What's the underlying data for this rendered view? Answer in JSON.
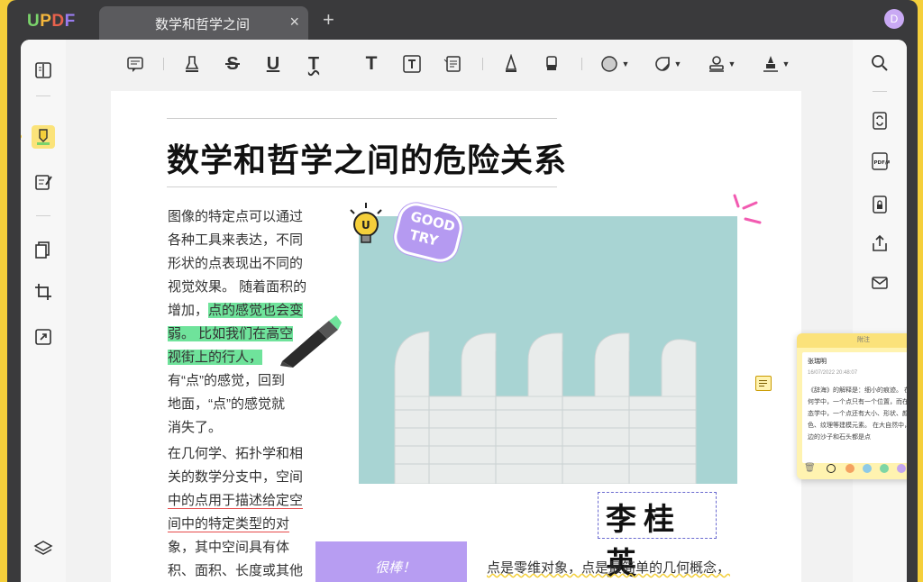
{
  "app": {
    "logo": "UPDF",
    "avatar_initial": "D"
  },
  "tabs": [
    {
      "title": "数学和哲学之间",
      "close": "×"
    }
  ],
  "new_tab": "+",
  "toolbar": {
    "tools": [
      "comment",
      "highlight",
      "strikethrough",
      "underline",
      "squiggly",
      "text",
      "textbox",
      "text-callout",
      "pencil",
      "eraser",
      "shape",
      "sticker",
      "stamp",
      "signature"
    ]
  },
  "document": {
    "title": "数学和哲学之间的危险关系",
    "left_col_1": [
      "图像的特定点可以通过",
      "各种工具来表达，不同",
      "形状的点表现出不同的",
      "视觉效果。 随着面积的"
    ],
    "left_col_hl": {
      "pre": "增加，",
      "hl1": "点的感觉也会变",
      "hl2": "弱。 比如我们在高空",
      "hl3": "视街上的行人，"
    },
    "left_col_2": [
      "有“点”的感觉，回到",
      "地面，“点”的感觉就",
      "消失了。"
    ],
    "left_col_3": [
      "在几何学、拓扑学和相",
      "关的数学分支中，空间"
    ],
    "left_col_ul": [
      "中的点用于描述给定空",
      "间中的特定类型的对"
    ],
    "left_col_4": [
      "象，其中空间具有体",
      "积、面积、长度或其他"
    ],
    "sticker_good": "GOOD",
    "sticker_try": "TRY",
    "bulb_letter": "U",
    "signature": "李桂英",
    "sticky_text": "很棒！",
    "bottom_para": "点是零维对象，点是最简单的几何概念，"
  },
  "note": {
    "header": "附注",
    "author": "张瑞明",
    "date": "16/07/2022 20:48:07",
    "body": "《辞海》的解释是：细小的痕迹。 在几何学中，一个点只有一个位置，而在形态学中，一个点还有大小、形状、颜色、纹理等建模元素。 在大自然中，海边的沙子和石头都是点",
    "colors": [
      "#222222",
      "#f4a261",
      "#8ecae6",
      "#7ed6a5",
      "#c3a6f0",
      "#f7a8c8"
    ]
  },
  "colors": {
    "accent": "#f5cf3b",
    "highlight": "#6fe39b",
    "underline": "#e64a4a",
    "sticky": "#b79df2"
  }
}
